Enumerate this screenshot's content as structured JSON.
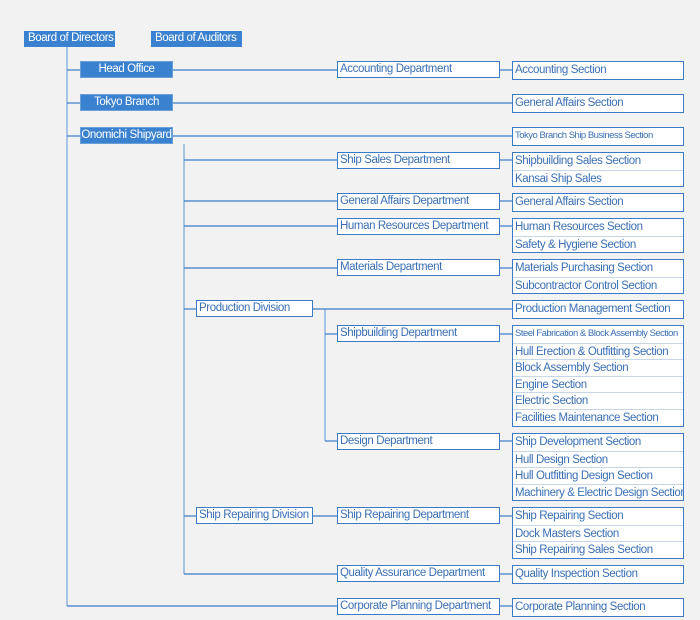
{
  "colors": {
    "accent": "#3a82d0",
    "line": "#3a7bc8",
    "light_line": "#8fb4e0",
    "text": "#3a6fb5",
    "background": "#f2f2f2"
  },
  "top": {
    "directors": "Board of Directors",
    "auditors": "Board of Auditors"
  },
  "units": {
    "head_office": "Head Office",
    "tokyo_branch": "Tokyo Branch",
    "onomichi": "Onomichi Shipyard"
  },
  "divisions": {
    "production": "Production Division",
    "ship_repairing": "Ship Repairing Division"
  },
  "departments": {
    "accounting": "Accounting Department",
    "ship_sales": "Ship Sales Department",
    "general_affairs": "General Affairs Department",
    "human_resources": "Human Resources Department",
    "materials": "Materials Department",
    "shipbuilding": "Shipbuilding Department",
    "design": "Design Department",
    "ship_repairing": "Ship Repairing Department",
    "quality_assurance": "Quality Assurance Department",
    "corporate_planning": "Corporate Planning Department"
  },
  "sections": {
    "accounting": [
      "Accounting Section"
    ],
    "tokyo_general_affairs": [
      "General Affairs Section"
    ],
    "tokyo_ship_business": [
      "Tokyo Branch Ship Business Section"
    ],
    "ship_sales": [
      "Shipbuilding Sales Section",
      "Kansai Ship Sales"
    ],
    "general_affairs": [
      "General Affairs Section"
    ],
    "human_resources": [
      "Human Resources Section",
      "Safety & Hygiene Section"
    ],
    "materials": [
      "Materials Purchasing Section",
      "Subcontractor Control Section"
    ],
    "production": [
      "Production Management Section"
    ],
    "shipbuilding": [
      "Steel Fabrication & Block Assembly Section",
      "Hull Erection & Outfitting Section",
      "Block Assembly Section",
      "Engine Section",
      "Electric Section",
      "Facilities Maintenance Section"
    ],
    "design": [
      "Ship Development Section",
      "Hull Design Section",
      "Hull Outfitting Design Section",
      "Machinery & Electric Design Section"
    ],
    "ship_repairing": [
      "Ship Repairing Section",
      "Dock Masters Section",
      "Ship Repairing Sales Section"
    ],
    "quality_assurance": [
      "Quality Inspection Section"
    ],
    "corporate_planning": [
      "Corporate Planning Section"
    ]
  }
}
